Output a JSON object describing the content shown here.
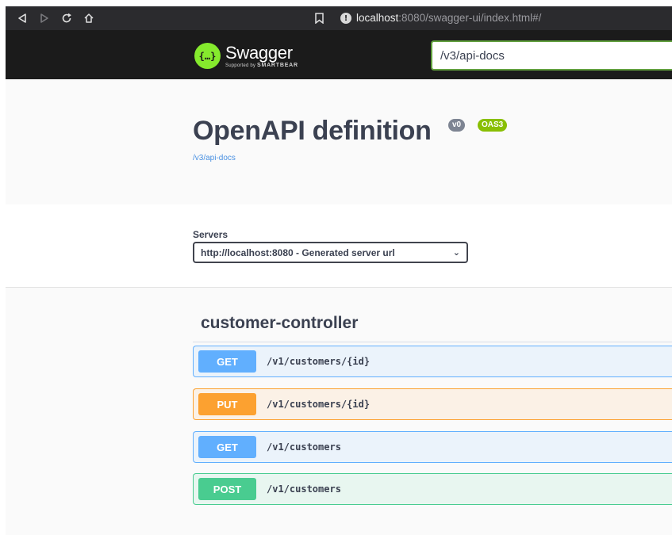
{
  "browser": {
    "url_host": "localhost",
    "url_rest": ":8080/swagger-ui/index.html#/"
  },
  "topbar": {
    "logo_title": "Swagger",
    "logo_sub_prefix": "Supported by",
    "logo_sub_brand": "SMARTBEAR",
    "logo_glyph": "{…}",
    "spec_url_value": "/v3/api-docs"
  },
  "info": {
    "title": "OpenAPI definition",
    "version_badge": "v0",
    "oas_badge": "OAS3",
    "spec_link": "/v3/api-docs"
  },
  "servers": {
    "label": "Servers",
    "selected": "http://localhost:8080 - Generated server url"
  },
  "tag": {
    "name": "customer-controller"
  },
  "operations": [
    {
      "method": "GET",
      "path": "/v1/customers/{id}",
      "color": "#61affe",
      "bg": "#ebf3fb",
      "border": "#61affe"
    },
    {
      "method": "PUT",
      "path": "/v1/customers/{id}",
      "color": "#fca130",
      "bg": "#fbf1e6",
      "border": "#fca130"
    },
    {
      "method": "GET",
      "path": "/v1/customers",
      "color": "#61affe",
      "bg": "#ebf3fb",
      "border": "#61affe"
    },
    {
      "method": "POST",
      "path": "/v1/customers",
      "color": "#49cc90",
      "bg": "#e8f6f0",
      "border": "#49cc90"
    }
  ],
  "colors": {
    "topbar_bg": "#1b1b1b",
    "swagger_green": "#85ea2d",
    "text": "#3b4151"
  }
}
